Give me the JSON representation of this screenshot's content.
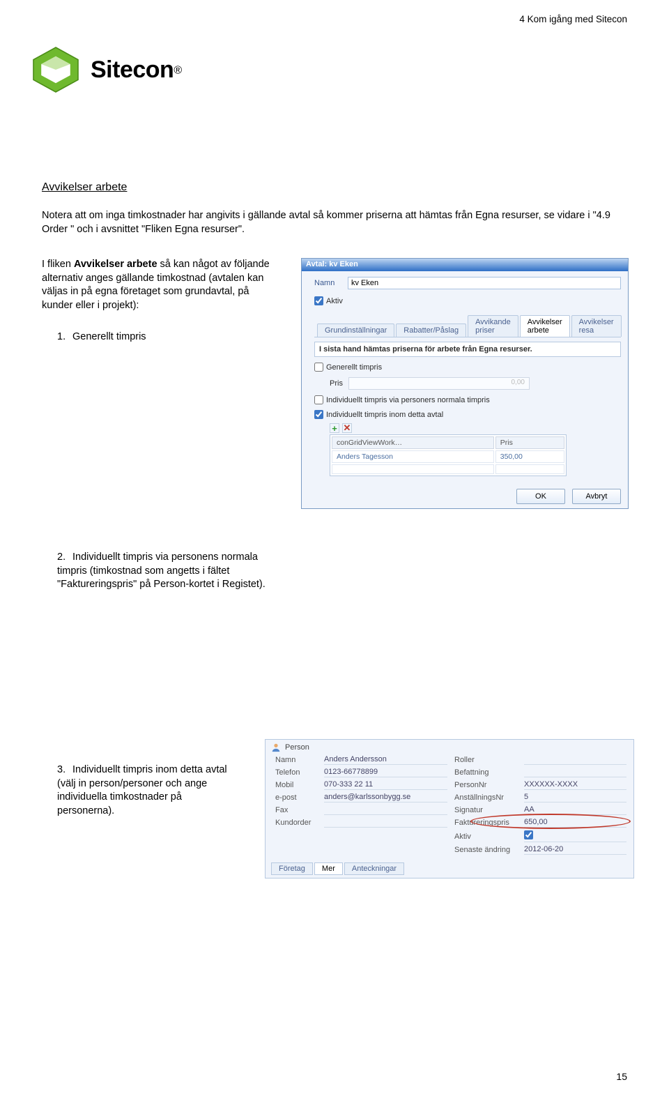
{
  "page_header": "4 Kom igång med Sitecon",
  "logo_text": "Sitecon",
  "section_title": "Avvikelser arbete",
  "intro": "Notera att om inga timkostnader har angivits i gällande avtal så kommer priserna att hämtas från Egna resurser, se vidare i \"4.9 Order \" och i avsnittet \"Fliken Egna resurser\".",
  "desc_lead": "I fliken ",
  "desc_bold": "Avvikelser arbete",
  "desc_tail": " så kan något av följande alternativ anges gällande timkostnad (avtalen kan väljas in på egna företaget som grundavtal, på kunder eller i projekt):",
  "li1": "Generellt timpris",
  "li2": "Individuellt timpris via personens normala timpris (timkostnad som angetts i fältet \"Faktureringspris\" på Person-kortet i Registet).",
  "li3": "Individuellt timpris inom detta avtal (välj in person/personer och ange individuella timkostnader på personerna).",
  "page_no": "15",
  "avtal": {
    "title": "Avtal: kv Eken",
    "name_label": "Namn",
    "name_value": "kv Eken",
    "aktiv_label": "Aktiv",
    "tabs": [
      "Grundinställningar",
      "Rabatter/Påslag",
      "Avvikande priser",
      "Avvikelser arbete",
      "Avvikelser resa"
    ],
    "active_tab": 3,
    "info": "I sista hand hämtas priserna för arbete från Egna resurser.",
    "checkbox1": "Generellt timpris",
    "pris_label": "Pris",
    "pris_value": "0,00",
    "checkbox2": "Individuellt timpris via personers normala timpris",
    "checkbox3": "Individuellt timpris inom detta avtal",
    "grid_cols": [
      "conGridViewWork…",
      "Pris"
    ],
    "grid_rows": [
      [
        "Anders Tagesson",
        "350,00"
      ]
    ],
    "ok": "OK",
    "cancel": "Avbryt"
  },
  "person": {
    "title": "Person",
    "left_labels": [
      "Namn",
      "Telefon",
      "Mobil",
      "e-post",
      "Fax",
      "Kundorder"
    ],
    "left_values": [
      "Anders Andersson",
      "0123-66778899",
      "070-333 22 11",
      "anders@karlssonbygg.se",
      "",
      ""
    ],
    "right_labels": [
      "Roller",
      "Befattning",
      "PersonNr",
      "AnställningsNr",
      "Signatur",
      "Faktureringspris",
      "Aktiv",
      "Senaste ändring"
    ],
    "right_values": [
      "",
      "",
      "XXXXXX-XXXX",
      "5",
      "AA",
      "650,00",
      "",
      "2012-06-20"
    ],
    "tabs": [
      "Företag",
      "Mer",
      "Anteckningar"
    ],
    "active_tab": 1
  }
}
